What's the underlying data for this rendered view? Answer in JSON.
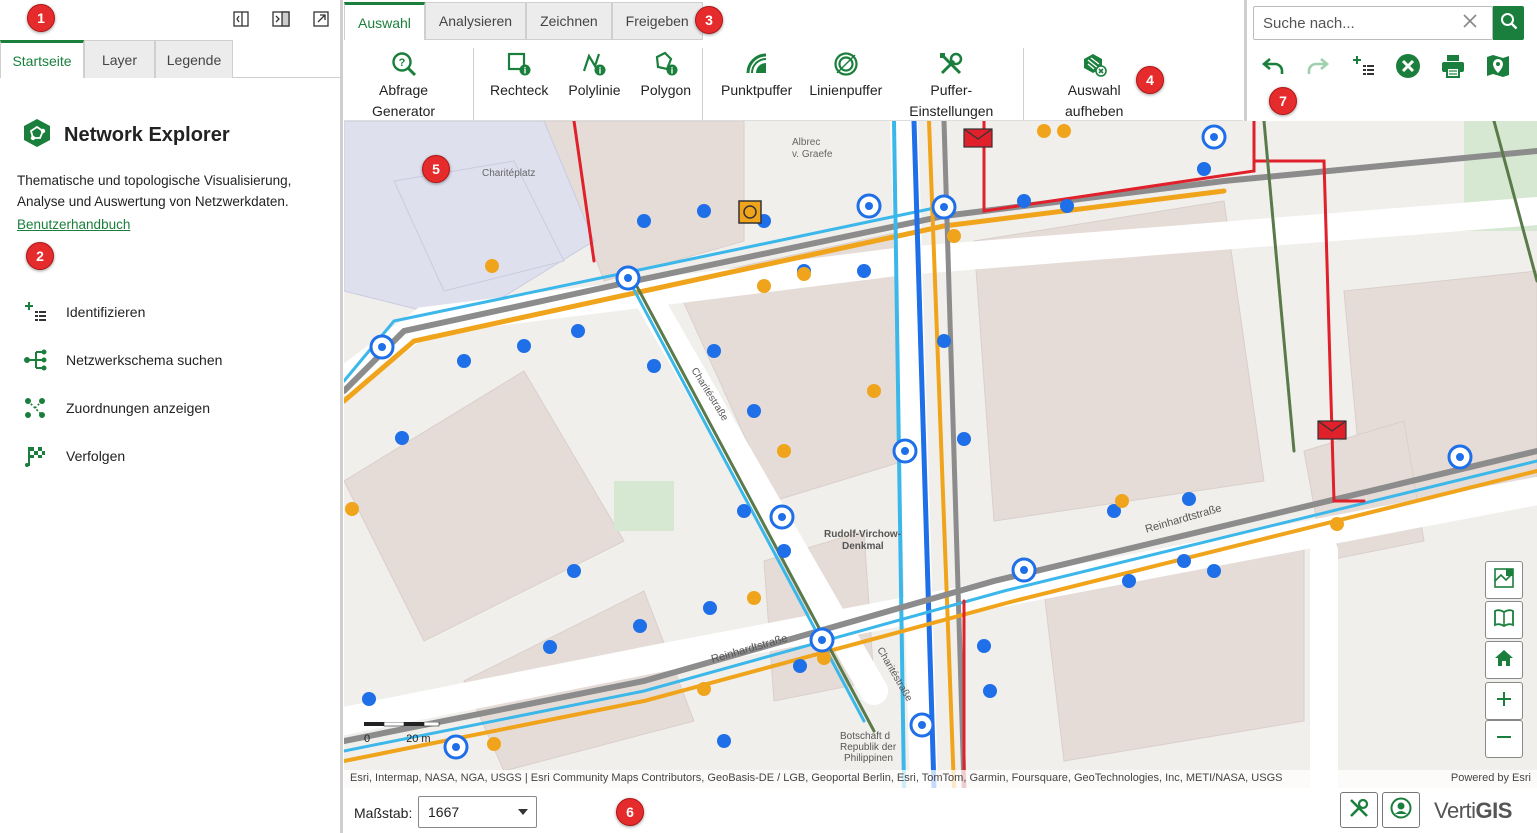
{
  "left_panel": {
    "tabs": [
      "Startseite",
      "Layer",
      "Legende"
    ],
    "title": "Network Explorer",
    "description": "Thematische und topologische Visualisierung, Analyse und Auswertung von Netzwerkdaten.",
    "manual_link": "Benutzerhandbuch",
    "menu": [
      {
        "label": "Identifizieren",
        "icon": "identify-list-icon"
      },
      {
        "label": "Netzwerkschema suchen",
        "icon": "network-schema-icon"
      },
      {
        "label": "Zuordnungen anzeigen",
        "icon": "associations-icon"
      },
      {
        "label": "Verfolgen",
        "icon": "trace-flag-icon"
      }
    ]
  },
  "ribbon": {
    "tabs": [
      "Auswahl",
      "Analysieren",
      "Zeichnen",
      "Freigeben"
    ],
    "buttons": {
      "abfrage_l1": "Abfrage",
      "abfrage_l2": "Generator",
      "rechteck": "Rechteck",
      "polylinie": "Polylinie",
      "polygon": "Polygon",
      "punktpuffer": "Punktpuffer",
      "linienpuffer": "Linienpuffer",
      "puffer_l1": "Puffer-",
      "puffer_l2": "Einstellungen",
      "auswahl_l1": "Auswahl",
      "auswahl_l2": "aufheben"
    }
  },
  "search": {
    "placeholder": "Suche nach..."
  },
  "map": {
    "labels": {
      "charitéplatz": "Charitéplatz",
      "albrecht1": "Albrec",
      "albrecht2": "v. Graefe",
      "charitestrasse": "Charitéstraße",
      "charitestrasse2": "Charitéstraße",
      "reinhardtstrasse": "Reinhardtstraße",
      "reinhardtstrasse2": "Reinhardtstraße",
      "virchow1": "Rudolf-Virchow-",
      "virchow2": "Denkmal",
      "botschaft1": "Botschaft d",
      "botschaft2": "Republik der",
      "botschaft3": "Philippinen"
    },
    "scale_left": "0",
    "scale_right": "20 m",
    "attribution": "Esri, Intermap, NASA, NGA, USGS | Esri Community Maps Contributors, GeoBasis-DE / LGB, Geoportal Berlin, Esri, TomTom, Garmin, Foursquare, GeoTechnologies, Inc, METI/NASA, USGS",
    "powered_by": "Powered by Esri"
  },
  "bottom": {
    "scale_label": "Maßstab:",
    "scale_value": "1667",
    "brand_a": "Verti",
    "brand_b": "GIS"
  },
  "badges": [
    "1",
    "2",
    "3",
    "4",
    "5",
    "6",
    "7"
  ],
  "colors": {
    "accent": "#1a7f3c",
    "badge": "#e52b2b",
    "line_orange": "#f0a41c",
    "line_blue": "#1e6fe8",
    "line_cyan": "#3cb7ea",
    "line_red": "#e0202a"
  }
}
